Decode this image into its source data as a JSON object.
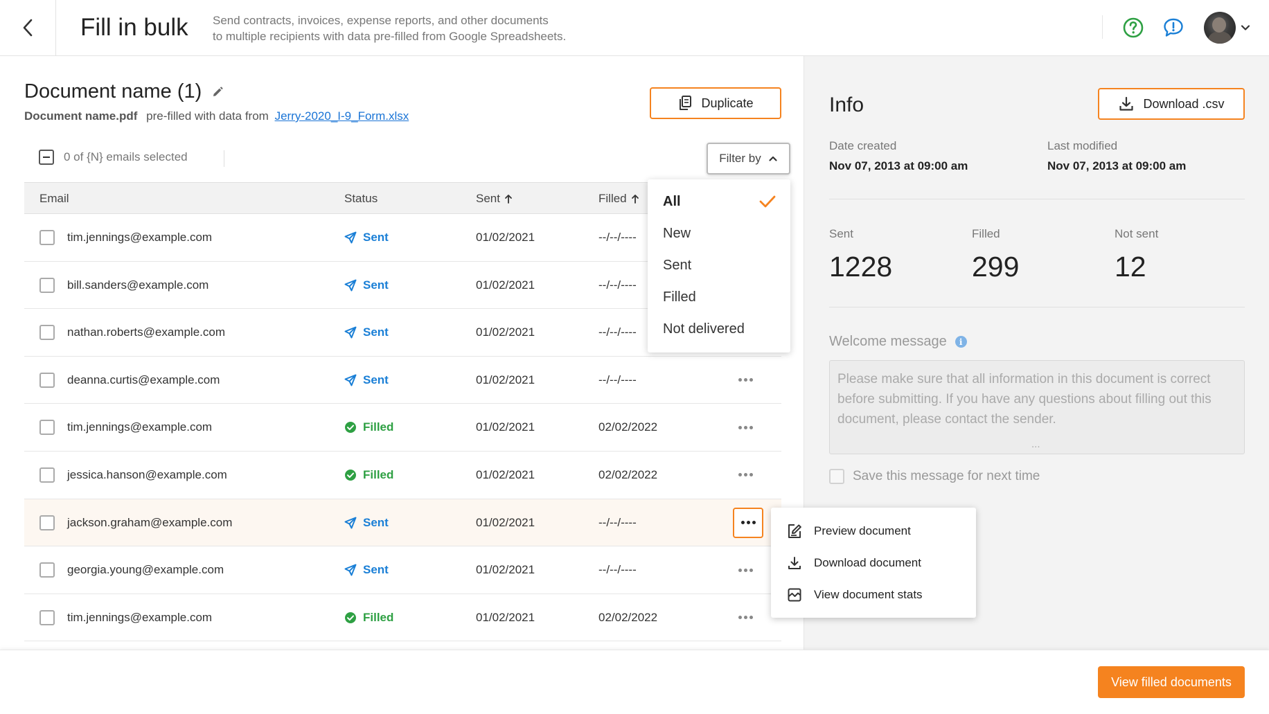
{
  "header": {
    "title": "Fill in bulk",
    "subtitle_line1": "Send contracts, invoices, expense reports, and other documents",
    "subtitle_line2": "to multiple recipients with data pre-filled from Google Spreadsheets."
  },
  "document": {
    "title": "Document name (1)",
    "file_name": "Document name.pdf",
    "prefill_text": "pre-filled with data from",
    "source_link": "Jerry-2020_I-9_Form.xlsx",
    "duplicate_label": "Duplicate"
  },
  "selection": {
    "label": "0 of {N} emails selected"
  },
  "filter": {
    "button_label": "Filter by",
    "options": [
      "All",
      "New",
      "Sent",
      "Filled",
      "Not delivered"
    ],
    "selected": "All"
  },
  "table": {
    "columns": {
      "email": "Email",
      "status": "Status",
      "sent": "Sent",
      "filled": "Filled"
    },
    "rows": [
      {
        "email": "tim.jennings@example.com",
        "status": "Sent",
        "sent": "01/02/2021",
        "filled": "--/--/----"
      },
      {
        "email": "bill.sanders@example.com",
        "status": "Sent",
        "sent": "01/02/2021",
        "filled": "--/--/----"
      },
      {
        "email": "nathan.roberts@example.com",
        "status": "Sent",
        "sent": "01/02/2021",
        "filled": "--/--/----"
      },
      {
        "email": "deanna.curtis@example.com",
        "status": "Sent",
        "sent": "01/02/2021",
        "filled": "--/--/----"
      },
      {
        "email": "tim.jennings@example.com",
        "status": "Filled",
        "sent": "01/02/2021",
        "filled": "02/02/2022"
      },
      {
        "email": "jessica.hanson@example.com",
        "status": "Filled",
        "sent": "01/02/2021",
        "filled": "02/02/2022"
      },
      {
        "email": "jackson.graham@example.com",
        "status": "Sent",
        "sent": "01/02/2021",
        "filled": "--/--/----"
      },
      {
        "email": "georgia.young@example.com",
        "status": "Sent",
        "sent": "01/02/2021",
        "filled": "--/--/----"
      },
      {
        "email": "tim.jennings@example.com",
        "status": "Filled",
        "sent": "01/02/2021",
        "filled": "02/02/2022"
      }
    ]
  },
  "action_menu": {
    "items": [
      {
        "label": "Preview document",
        "icon": "edit-document-icon"
      },
      {
        "label": "Download document",
        "icon": "download-icon"
      },
      {
        "label": "View document stats",
        "icon": "stats-icon"
      }
    ]
  },
  "info": {
    "title": "Info",
    "download_label": "Download .csv",
    "date_created_label": "Date created",
    "date_created_value": "Nov 07, 2013 at 09:00 am",
    "last_modified_label": "Last modified",
    "last_modified_value": "Nov 07, 2013 at 09:00 am",
    "stats": [
      {
        "label": "Sent",
        "value": "1228"
      },
      {
        "label": "Filled",
        "value": "299"
      },
      {
        "label": "Not sent",
        "value": "12"
      }
    ],
    "welcome_label": "Welcome message",
    "welcome_placeholder": "Please make sure that all information in this document is correct before submitting. If you have any questions about filling out this document, please contact the sender.",
    "welcome_ellipsis": "...",
    "save_label": "Save this message for next time"
  },
  "footer": {
    "primary_label": "View filled documents"
  },
  "colors": {
    "accent": "#f5831f",
    "link": "#1a74d6",
    "sent": "#1a7fd6",
    "filled": "#2ea043",
    "help": "#2ea043"
  }
}
